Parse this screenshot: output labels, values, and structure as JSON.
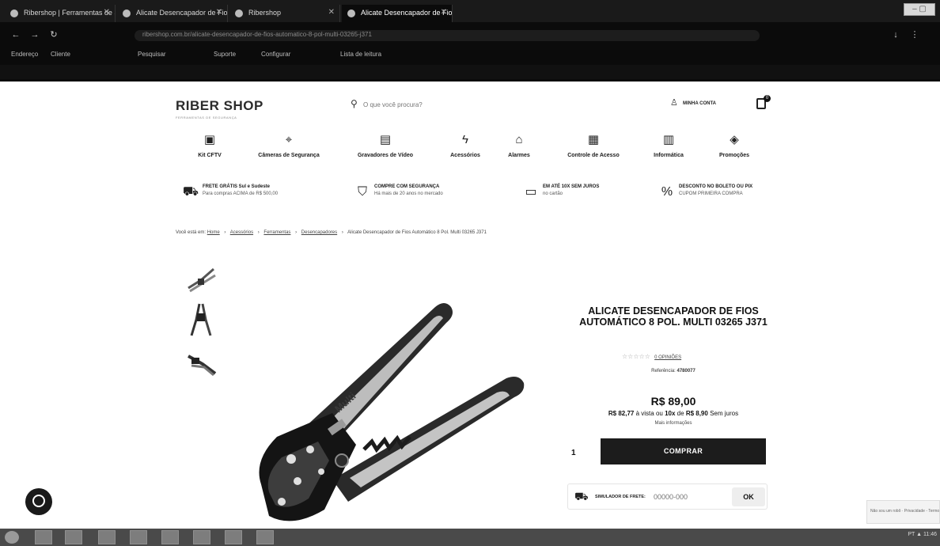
{
  "browser": {
    "tabs": [
      {
        "label": "Ribershop | Ferramentas de Segurança"
      },
      {
        "label": "Alicate Desencapador de Fios"
      },
      {
        "label": "Ribershop"
      },
      {
        "label": "Alicate Desencapador de Fios Automático"
      }
    ],
    "url": "ribershop.com.br/alicate-desencapador-de-fios-automatico-8-pol-multi-03265-j371",
    "bookmarks": [
      "Endereço",
      "Cliente",
      "Pesquisar",
      "Suporte",
      "Configurar",
      "Lista de leitura"
    ]
  },
  "store": {
    "logo": "RIBER SHOP",
    "tagline": "FERRAMENTAS DE SEGURANÇA",
    "search_placeholder": "O que você procura?",
    "account_label": "MINHA CONTA",
    "cart_count": "0"
  },
  "categories": [
    {
      "label": "Kit CFTV",
      "icon": "cctv-kit-icon"
    },
    {
      "label": "Câmeras de Segurança",
      "icon": "security-camera-icon"
    },
    {
      "label": "Gravadores de Vídeo",
      "icon": "video-recorder-icon"
    },
    {
      "label": "Acessórios",
      "icon": "lightning-icon"
    },
    {
      "label": "Alarmes",
      "icon": "alarm-house-icon"
    },
    {
      "label": "Controle de Acesso",
      "icon": "access-control-icon"
    },
    {
      "label": "Informática",
      "icon": "computer-icon"
    },
    {
      "label": "Promoções",
      "icon": "promo-tag-icon"
    }
  ],
  "benefits": [
    {
      "title": "FRETE GRÁTIS Sul e Sudeste",
      "subtitle": "Para compras ACIMA de R$ 500,00",
      "icon": "truck-icon"
    },
    {
      "title": "COMPRE COM SEGURANÇA",
      "subtitle": "Há mais de 20 anos no mercado",
      "icon": "shield-check-icon"
    },
    {
      "title": "EM ATÉ 10X SEM JUROS",
      "subtitle": "no cartão",
      "icon": "credit-card-icon"
    },
    {
      "title": "DESCONTO NO BOLETO OU PIX",
      "subtitle": "CUPOM PRIMEIRA COMPRA",
      "icon": "discount-tag-icon"
    }
  ],
  "breadcrumb": {
    "prefix": "Você está em:",
    "items": [
      "Home",
      "Acessórios",
      "Ferramentas",
      "Desencapadores"
    ],
    "current": "Alicate Desencapador de Fios Automático 8 Pol. Multi 03265 J371"
  },
  "product": {
    "title": "ALICATE DESENCAPADOR DE FIOS AUTOMÁTICO 8 POL. MULTI 03265 J371",
    "stars": "☆☆☆☆☆",
    "rating_text": "0 OPINIÕES",
    "reference_label": "Referência:",
    "reference": "4780077",
    "price": "R$ 89,00",
    "installments": {
      "cash_price": "R$ 82,77",
      "cash_text": "à vista ou",
      "count": "10x",
      "of": "de",
      "value": "R$ 8,90",
      "suffix": "Sem juros"
    },
    "more_payment": "Mais informações",
    "quantity": "1",
    "buy_label": "COMPRAR",
    "freight_label": "SIMULADOR DE FRETE:",
    "freight_placeholder": "00000-000",
    "freight_ok": "OK"
  },
  "recaptcha": "Não sou um robô · Privacidade - Termos",
  "taskbar": {
    "tray": "PT ▲ 11:46"
  }
}
